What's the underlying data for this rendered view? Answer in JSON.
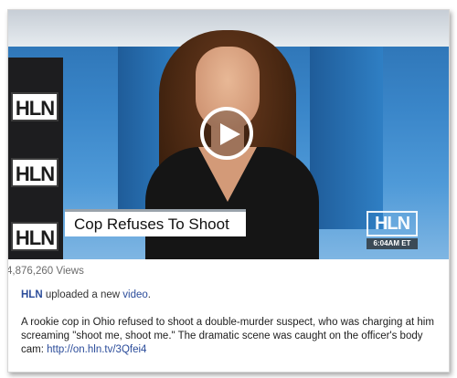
{
  "video": {
    "headline": "Cop Refuses To Shoot",
    "channel_logo": "HLN",
    "corner_logo": "HLN",
    "timestamp": "6:04AM ET",
    "play_icon": "play-icon"
  },
  "post": {
    "views": "4,876,260 Views",
    "uploader": "HLN",
    "uploaded_text": "uploaded a new",
    "video_link": "video",
    "period": ".",
    "description": "A rookie cop in Ohio refused to shoot a double-murder suspect, who was charging at him screaming \"shoot me, shoot me.\" The dramatic scene was caught on the officer's body cam: ",
    "short_link": "http://on.hln.tv/3Qfei4"
  },
  "colors": {
    "link": "#2b4c9a",
    "lower_third_bg": "#ffffff",
    "studio_blue": "#3a86c9"
  }
}
